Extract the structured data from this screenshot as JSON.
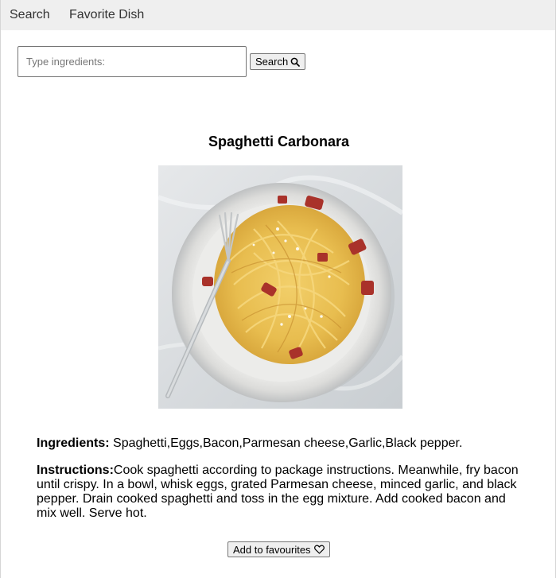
{
  "nav": {
    "items": [
      {
        "label": "Search"
      },
      {
        "label": "Favorite Dish"
      }
    ]
  },
  "search": {
    "placeholder": "Type ingredients:",
    "button_label": "Search",
    "button_icon": "search-icon"
  },
  "recipe": {
    "title": "Spaghetti Carbonara",
    "image_alt": "Spaghetti Carbonara",
    "ingredients_label": "Ingredients:",
    "ingredients_text": "Spaghetti,Eggs,Bacon,Parmesan cheese,Garlic,Black pepper.",
    "instructions_label": "Instructions:",
    "instructions_text": "Cook spaghetti according to package instructions. Meanwhile, fry bacon until crispy. In a bowl, whisk eggs, grated Parmesan cheese, minced garlic, and black pepper. Drain cooked spaghetti and toss in the egg mixture. Add cooked bacon and mix well. Serve hot."
  },
  "favourites": {
    "button_label": "Add to favourites",
    "button_icon": "heart-icon"
  },
  "colors": {
    "navbar_bg": "#efefef",
    "button_bg": "#efefef",
    "border": "#767676"
  }
}
